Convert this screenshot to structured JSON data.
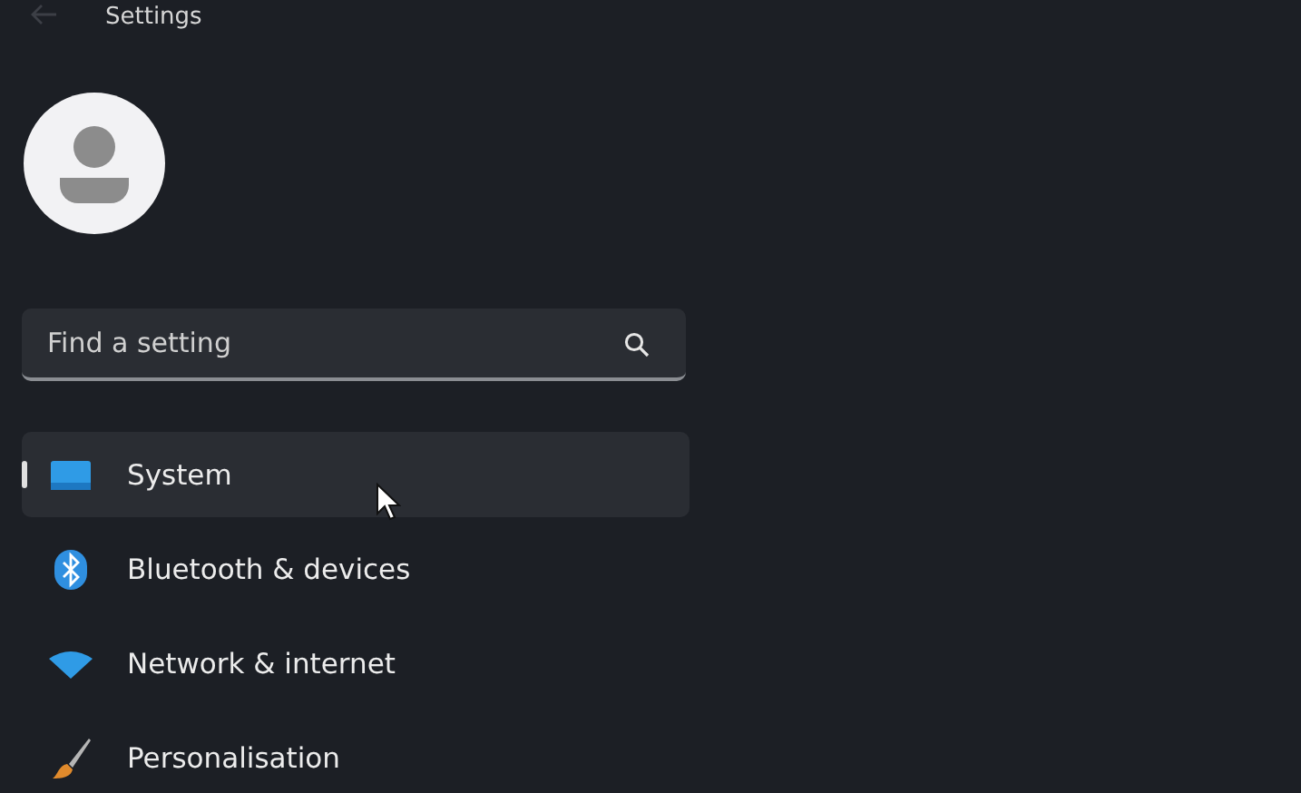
{
  "window": {
    "title": "Settings"
  },
  "search": {
    "placeholder": "Find a setting"
  },
  "nav": [
    {
      "label": "System",
      "kind": "system",
      "selected": true
    },
    {
      "label": "Bluetooth & devices",
      "kind": "bluetooth",
      "selected": false
    },
    {
      "label": "Network & internet",
      "kind": "network",
      "selected": false
    },
    {
      "label": "Personalisation",
      "kind": "brush",
      "selected": false
    }
  ]
}
